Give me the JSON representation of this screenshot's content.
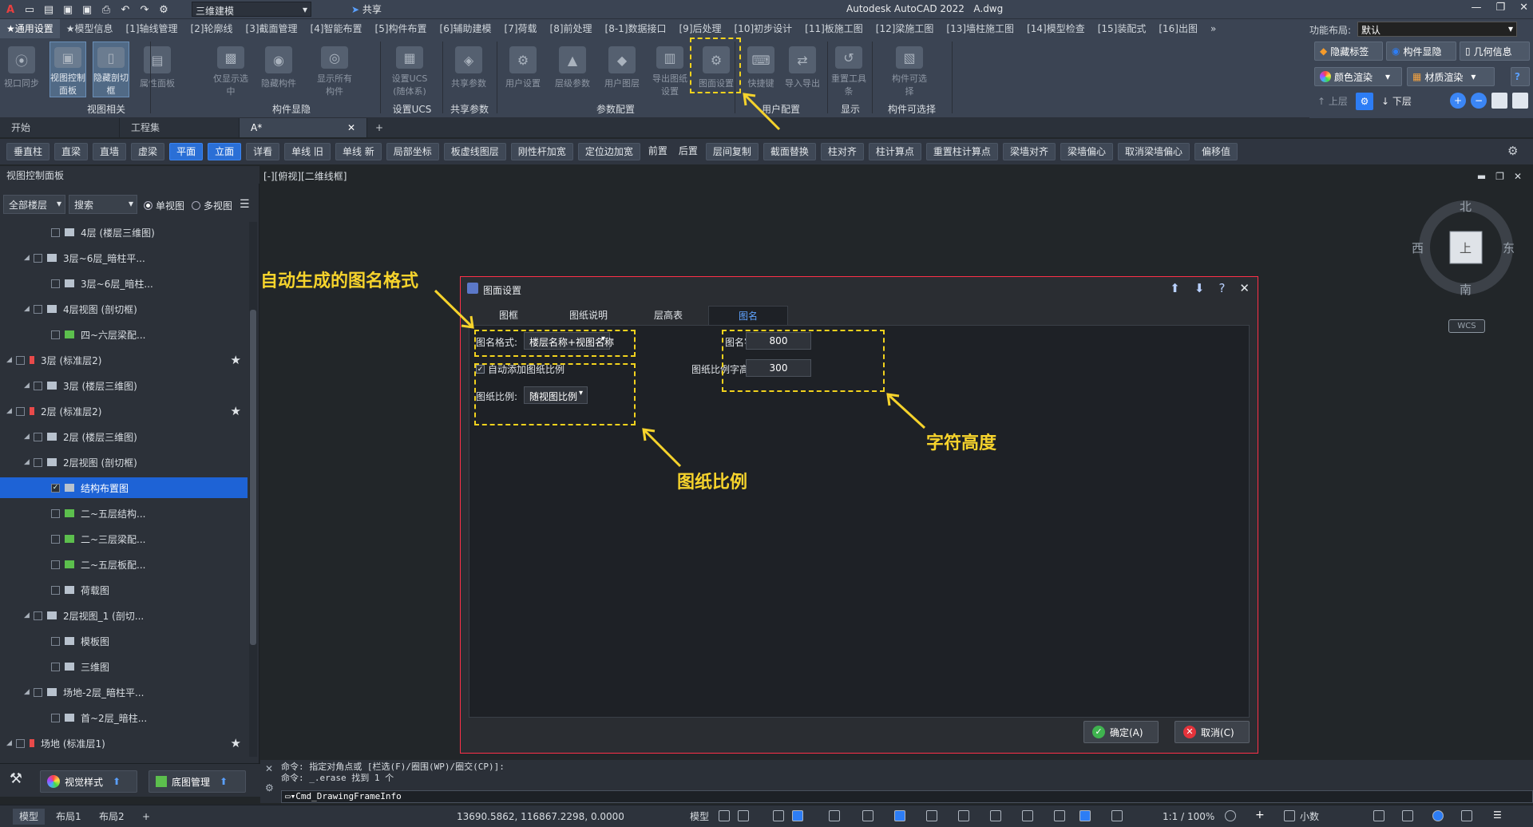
{
  "titlebar": {
    "workspace": "三维建模",
    "share": "共享",
    "app_title": "Autodesk AutoCAD 2022",
    "file_name": "A.dwg"
  },
  "ribbon_tabs": [
    "★通用设置",
    "★模型信息",
    "[1]轴线管理",
    "[2]轮廓线",
    "[3]截面管理",
    "[4]智能布置",
    "[5]构件布置",
    "[6]辅助建模",
    "[7]荷载",
    "[8]前处理",
    "[8-1]数据接口",
    "[9]后处理",
    "[10]初步设计",
    "[11]板施工图",
    "[12]梁施工图",
    "[13]墙柱施工图",
    "[14]模型检查",
    "[15]装配式",
    "[16]出图"
  ],
  "layout": {
    "label": "功能布局:",
    "value": "默认"
  },
  "ribbon": {
    "buttons": [
      {
        "label": "视口同步",
        "icon": "viewport-sync-icon"
      },
      {
        "label": "视图控制面板",
        "icon": "view-panel-icon",
        "active": true
      },
      {
        "label": "隐藏剖切框",
        "icon": "hide-section-box-icon",
        "active": true
      },
      {
        "label": "属性面板",
        "icon": "properties-panel-icon"
      },
      {
        "label": "仅显示选中",
        "icon": "isolate-icon"
      },
      {
        "label": "隐藏构件",
        "icon": "hide-object-icon"
      },
      {
        "label": "显示所有构件",
        "icon": "show-all-icon"
      },
      {
        "label": "设置UCS\n(随体系)",
        "icon": "ucs-icon"
      },
      {
        "label": "共享参数",
        "icon": "share-params-icon"
      },
      {
        "label": "用户设置",
        "icon": "user-settings-icon"
      },
      {
        "label": "层级参数",
        "icon": "level-params-icon"
      },
      {
        "label": "用户图层",
        "icon": "user-layer-icon"
      },
      {
        "label": "导出图纸设置",
        "icon": "export-settings-icon"
      },
      {
        "label": "图面设置",
        "icon": "drawing-settings-icon"
      },
      {
        "label": "快捷键",
        "icon": "keyboard-icon"
      },
      {
        "label": "导入导出",
        "icon": "import-export-icon"
      },
      {
        "label": "重置工具条",
        "icon": "reset-toolbar-icon"
      },
      {
        "label": "构件可选择",
        "icon": "selectable-icon"
      }
    ],
    "groups": [
      "视图相关",
      "构件显隐",
      "设置UCS",
      "共享参数",
      "参数配置",
      "用户配置",
      "显示",
      "构件可选择"
    ],
    "right": {
      "hide_tags": "隐藏标签",
      "show_hide": "构件显隐",
      "geometry": "几何信息",
      "color_render": "颜色渲染",
      "material_render": "材质渲染",
      "up_floor": "上层",
      "down_floor": "下层"
    }
  },
  "doc_tabs": [
    "开始",
    "工程集",
    "A*"
  ],
  "toolbar": [
    "垂直柱",
    "直梁",
    "直墙",
    "虚梁",
    "平面",
    "立面",
    "详看",
    "单线 旧",
    "单线 新",
    "局部坐标",
    "板虚线图层",
    "刚性杆加宽",
    "定位边加宽",
    "前置",
    "后置",
    "层间复制",
    "截面替换",
    "柱对齐",
    "柱计算点",
    "重置柱计算点",
    "梁墙对齐",
    "梁墙偏心",
    "取消梁墙偏心",
    "偏移值"
  ],
  "left_panel": {
    "title": "视图控制面板",
    "floor_select": "全部楼层",
    "search": "搜索",
    "single_view": "单视图",
    "multi_view": "多视图",
    "tree": [
      {
        "text": "4层 (楼层三维图)",
        "level": 2
      },
      {
        "text": "3层~6层_暗柱平...",
        "level": 1
      },
      {
        "text": "3层~6层_暗柱...",
        "level": 2
      },
      {
        "text": "4层视图 (剖切框)",
        "level": 1
      },
      {
        "text": "四~六层梁配...",
        "level": 2
      },
      {
        "text": "3层 (标准层2)",
        "level": 0
      },
      {
        "text": "3层 (楼层三维图)",
        "level": 1
      },
      {
        "text": "2层 (标准层2)",
        "level": 0
      },
      {
        "text": "2层 (楼层三维图)",
        "level": 1
      },
      {
        "text": "2层视图 (剖切框)",
        "level": 1
      },
      {
        "text": "结构布置图",
        "level": 2,
        "selected": true
      },
      {
        "text": "二~五层结构...",
        "level": 2
      },
      {
        "text": "二~三层梁配...",
        "level": 2
      },
      {
        "text": "二~五层板配...",
        "level": 2
      },
      {
        "text": "荷载图",
        "level": 2
      },
      {
        "text": "2层视图_1 (剖切...",
        "level": 1
      },
      {
        "text": "模板图",
        "level": 2
      },
      {
        "text": "三维图",
        "level": 2
      },
      {
        "text": "场地-2层_暗柱平...",
        "level": 1
      },
      {
        "text": "首~2层_暗柱...",
        "level": 2
      },
      {
        "text": "场地 (标准层1)",
        "level": 0
      }
    ],
    "bottom": {
      "visual_style": "视觉样式",
      "base_map": "底图管理"
    }
  },
  "viewport": {
    "label": "[-][俯视][二维线框]",
    "compass": {
      "north": "北",
      "south": "南",
      "east": "东",
      "west": "西",
      "top": "上"
    },
    "wcs": "WCS"
  },
  "annotations": {
    "format": "自动生成的图名格式",
    "scale": "图纸比例",
    "height": "字符高度"
  },
  "dialog": {
    "title": "图面设置",
    "tabs": [
      "图框",
      "图纸说明",
      "层高表",
      "图名"
    ],
    "active_tab": "图名",
    "name_format_label": "图名格式:",
    "name_format_value": "楼层名称+视图名称",
    "auto_scale_label": "自动添加图纸比例",
    "auto_scale_checked": true,
    "scale_label": "图纸比例:",
    "scale_value": "随视图比例",
    "name_height_label": "图名字高:",
    "name_height_value": "800",
    "scale_height_label": "图纸比例字高:",
    "scale_height_value": "300",
    "ok": "确定(A)",
    "cancel": "取消(C)"
  },
  "command": {
    "line1": "命令: 指定对角点或 [栏选(F)/圈围(WP)/圈交(CP)]:",
    "line2": "命令: _.erase 找到 1 个",
    "input": "Cmd_DrawingFrameInfo"
  },
  "status": {
    "tabs": [
      "模型",
      "布局1",
      "布局2"
    ],
    "coords": "13690.5862, 116867.2298, 0.0000",
    "model": "模型",
    "scale": "1:1 / 100%",
    "units": "小数"
  }
}
